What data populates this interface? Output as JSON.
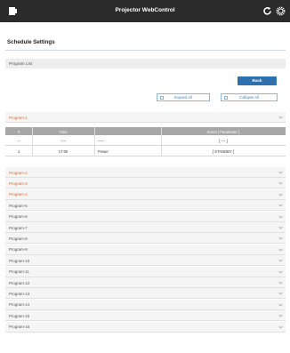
{
  "app": {
    "title": "Projector WebControl"
  },
  "page": {
    "title": "Schedule Settings",
    "section": "Program List"
  },
  "buttons": {
    "back": "Back",
    "expand_all": "Expand All",
    "collapse_all": "Collapse All"
  },
  "colors": {
    "topbar": "#2b2b2b",
    "accent": "#2e6fae",
    "highlight": "#e0682b"
  },
  "program1": {
    "label": "Program-1",
    "columns": [
      "#",
      "Time",
      "Event [ Parameter ]"
    ],
    "rows": [
      {
        "num": "–",
        "time": "–:–",
        "event": "–––",
        "param": "[ –– ]"
      },
      {
        "num": "1",
        "time": "17:00",
        "event": "Power",
        "param": "[ STANDBY ]"
      }
    ]
  },
  "programs": [
    {
      "label": "Program-2",
      "highlight": true
    },
    {
      "label": "Program-3",
      "highlight": true
    },
    {
      "label": "Program-4",
      "highlight": true
    },
    {
      "label": "Program-5",
      "highlight": false
    },
    {
      "label": "Program-6",
      "highlight": false
    },
    {
      "label": "Program-7",
      "highlight": false
    },
    {
      "label": "Program-8",
      "highlight": false
    },
    {
      "label": "Program-9",
      "highlight": false
    },
    {
      "label": "Program-10",
      "highlight": false
    },
    {
      "label": "Program-11",
      "highlight": false
    },
    {
      "label": "Program-12",
      "highlight": false
    },
    {
      "label": "Program-13",
      "highlight": false
    },
    {
      "label": "Program-14",
      "highlight": false
    },
    {
      "label": "Program-15",
      "highlight": false
    },
    {
      "label": "Program-16",
      "highlight": false
    }
  ],
  "icons": {
    "menu": "menu-icon",
    "refresh": "refresh-icon",
    "settings": "gear-icon",
    "expand": "chevron-down-icon"
  }
}
